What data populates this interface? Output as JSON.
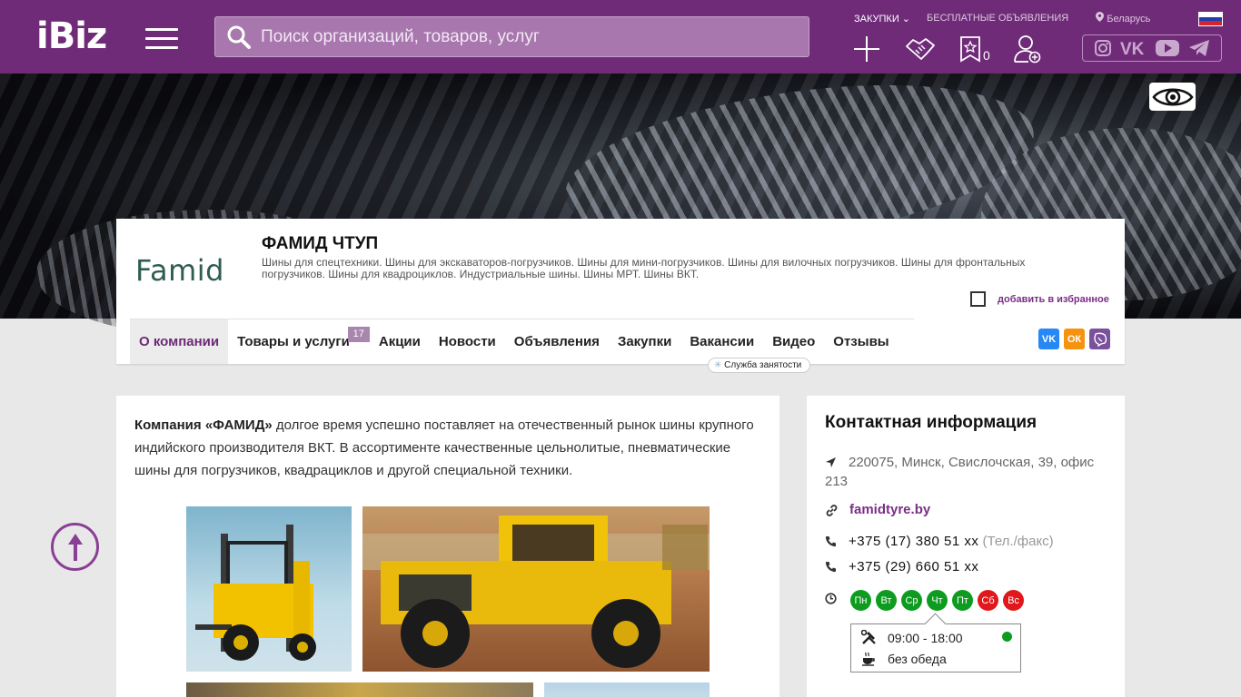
{
  "header": {
    "logo": "iBiz",
    "search_placeholder": "Поиск организаций, товаров, услуг",
    "links": {
      "purchases": "ЗАКУПКИ",
      "free_ads": "БЕСПЛАТНЫЕ ОБЪЯВЛЕНИЯ",
      "region": "Беларусь"
    },
    "favorites_count": "0",
    "colors": {
      "brand": "#6f2b78"
    }
  },
  "company": {
    "logo_text": "Famid",
    "name": "ФАМИД ЧТУП",
    "description": "Шины для спецтехники. Шины для экскаваторов-погрузчиков. Шины для мини-погрузчиков. Шины для вилочных погрузчиков. Шины для фронтальных погрузчиков. Шины для квадроциклов. Индустриальные шины. Шины МРТ. Шины ВКТ.",
    "add_favorite": "добавить в избранное"
  },
  "tabs": [
    {
      "label": "О компании",
      "active": true
    },
    {
      "label": "Товары и услуги",
      "badge": "17"
    },
    {
      "label": "Акции"
    },
    {
      "label": "Новости"
    },
    {
      "label": "Объявления"
    },
    {
      "label": "Закупки"
    },
    {
      "label": "Вакансии"
    },
    {
      "label": "Видео"
    },
    {
      "label": "Отзывы"
    }
  ],
  "jobs_tooltip": "Служба занятости",
  "about": {
    "lead": "Компания «ФАМИД»",
    "text": " долгое время успешно поставляет на отечественный рынок  шины крупного индийского производителя ВКТ. В ассортименте качественные цельнолитые, пневматические шины для погрузчиков, квадрациклов и другой специальной техники."
  },
  "contacts": {
    "title": "Контактная информация",
    "address": "220075, Минск, Свислочская, 39, офис 213",
    "site": "famidtyre.by",
    "phone1": "+375 (17) 380 51 xx",
    "phone1_note": " (Тел./факс)",
    "phone2": "+375 (29) 660 51 xx",
    "days": [
      {
        "label": "Пн",
        "working": true
      },
      {
        "label": "Вт",
        "working": true
      },
      {
        "label": "Ср",
        "working": true
      },
      {
        "label": "Чт",
        "working": true
      },
      {
        "label": "Пт",
        "working": true
      },
      {
        "label": "Сб",
        "working": false
      },
      {
        "label": "Вс",
        "working": false
      }
    ],
    "hours": "09:00 - 18:00",
    "lunch": "без обеда"
  }
}
